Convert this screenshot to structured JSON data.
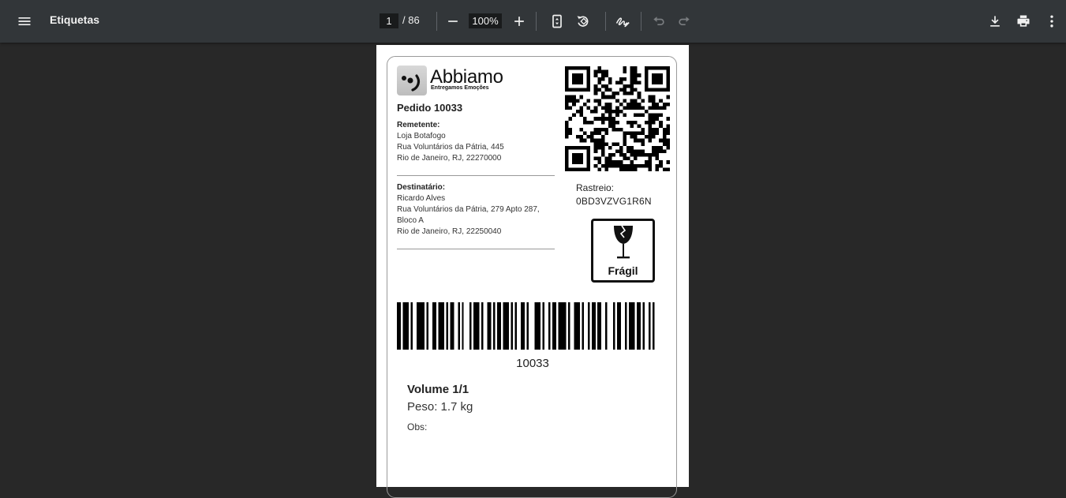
{
  "toolbar": {
    "title": "Etiquetas",
    "page_current": "1",
    "page_total": "/ 86",
    "zoom": "100%",
    "icons": {
      "menu": "menu-icon",
      "zoom_out": "minus-icon",
      "zoom_in": "plus-icon",
      "fit": "fit-page-icon",
      "rotate": "rotate-icon",
      "annotate": "annotate-pen-icon",
      "undo": "undo-icon",
      "redo": "redo-icon",
      "download": "download-icon",
      "print": "print-icon",
      "more": "more-vertical-icon"
    }
  },
  "label": {
    "brand": "Abbiamo",
    "tagline": "Entregamos Emoções",
    "order": "Pedido 10033",
    "sender": {
      "label": "Remetente:",
      "lines": [
        "Loja Botafogo",
        "Rua Voluntários da Pátria, 445",
        "Rio de Janeiro, RJ, 22270000"
      ]
    },
    "recipient": {
      "label": "Destinatário:",
      "lines": [
        "Ricardo Alves",
        "Rua Voluntários da Pátria, 279 Apto 287,",
        "Bloco A",
        "Rio de Janeiro, RJ, 22250040"
      ]
    },
    "tracking_label": "Rastreio:",
    "tracking_code": "0BD3VZVG1R6N",
    "fragile": "Frágil",
    "barcode_value": "10033",
    "volume": "Volume 1/1",
    "weight": "Peso: 1.7 kg",
    "obs": "Obs:"
  },
  "colors": {
    "toolbar_bg": "#323639",
    "viewer_bg": "#282828",
    "input_bg": "#191b1c",
    "page_bg": "#ffffff"
  }
}
